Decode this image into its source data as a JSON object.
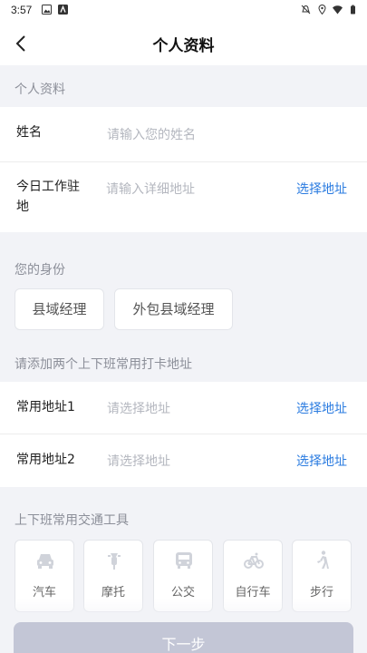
{
  "status_bar": {
    "time": "3:57"
  },
  "header": {
    "title": "个人资料"
  },
  "profile": {
    "section_title": "个人资料",
    "name_label": "姓名",
    "name_placeholder": "请输入您的姓名",
    "work_label_line1": "今日工作驻",
    "work_label_line2": "地",
    "work_placeholder": "请输入详细地址",
    "select_address": "选择地址"
  },
  "identity": {
    "section_title": "您的身份",
    "options": [
      "县域经理",
      "外包县域经理"
    ]
  },
  "addresses": {
    "section_title": "请添加两个上下班常用打卡地址",
    "rows": [
      {
        "label": "常用地址1",
        "placeholder": "请选择地址",
        "action": "选择地址"
      },
      {
        "label": "常用地址2",
        "placeholder": "请选择地址",
        "action": "选择地址"
      }
    ]
  },
  "transport": {
    "section_title": "上下班常用交通工具",
    "options": [
      {
        "label": "汽车",
        "icon": "car-icon"
      },
      {
        "label": "摩托",
        "icon": "motorbike-icon"
      },
      {
        "label": "公交",
        "icon": "bus-icon"
      },
      {
        "label": "自行车",
        "icon": "bicycle-icon"
      },
      {
        "label": "步行",
        "icon": "walk-icon"
      }
    ]
  },
  "footer": {
    "next_label": "下一步"
  },
  "colors": {
    "accent": "#2a7be0",
    "background": "#f2f3f7",
    "button_disabled": "#c3c6d6"
  }
}
